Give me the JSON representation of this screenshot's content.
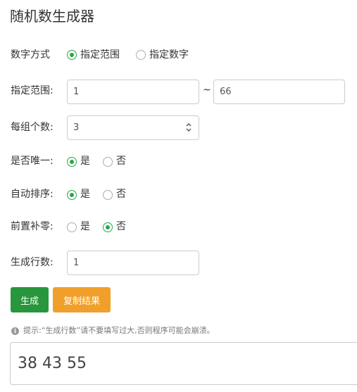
{
  "title": "随机数生成器",
  "mode": {
    "label": "数字方式",
    "options": [
      "指定范围",
      "指定数字"
    ],
    "selected": "指定范围"
  },
  "range": {
    "label": "指定范围:",
    "min": "1",
    "separator": "~",
    "max": "66"
  },
  "count": {
    "label": "每组个数:",
    "value": "3"
  },
  "unique": {
    "label": "是否唯一:",
    "yes": "是",
    "no": "否",
    "selected": "是"
  },
  "sort": {
    "label": "自动排序:",
    "yes": "是",
    "no": "否",
    "selected": "是"
  },
  "leading_zero": {
    "label": "前置补零:",
    "yes": "是",
    "no": "否",
    "selected": "否"
  },
  "rows": {
    "label": "生成行数:",
    "value": "1"
  },
  "buttons": {
    "generate": "生成",
    "copy": "复制结果"
  },
  "hint": "提示:“生成行数”请不要填写过大,否则程序可能会崩溃。",
  "result": "38 43 55",
  "colors": {
    "primary_green": "#28963c",
    "copy_orange": "#f0a02a",
    "radio_green": "#28a745"
  }
}
